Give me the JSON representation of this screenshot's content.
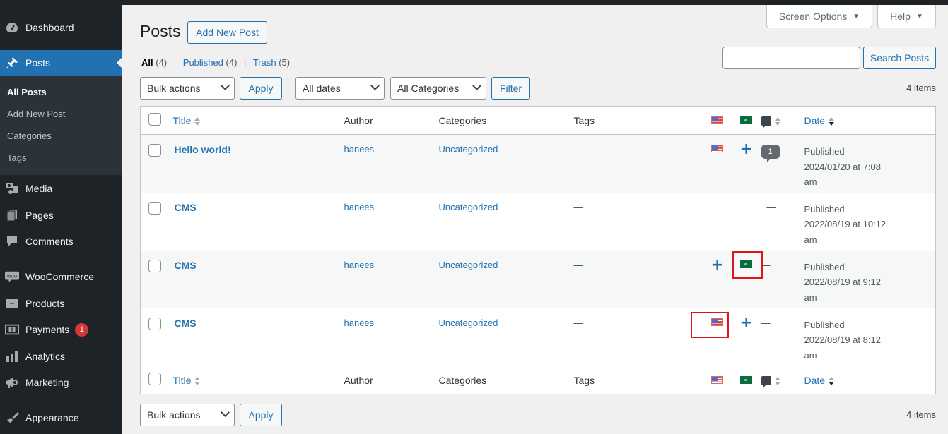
{
  "sidebar": {
    "items": [
      {
        "label": "Dashboard",
        "icon": "dashboard-icon"
      },
      {
        "label": "Posts",
        "icon": "pin-icon",
        "active": true
      },
      {
        "label": "Media",
        "icon": "media-icon"
      },
      {
        "label": "Pages",
        "icon": "pages-icon"
      },
      {
        "label": "Comments",
        "icon": "comments-icon"
      },
      {
        "label": "WooCommerce",
        "icon": "woocommerce-icon"
      },
      {
        "label": "Products",
        "icon": "archive-box-icon"
      },
      {
        "label": "Payments",
        "icon": "dollar-card-icon",
        "badge": "1"
      },
      {
        "label": "Analytics",
        "icon": "bar-chart-icon"
      },
      {
        "label": "Marketing",
        "icon": "megaphone-icon"
      },
      {
        "label": "Appearance",
        "icon": "paintbrush-icon"
      }
    ],
    "submenu": [
      "All Posts",
      "Add New Post",
      "Categories",
      "Tags"
    ]
  },
  "header": {
    "screen_options": "Screen Options",
    "help": "Help",
    "title": "Posts",
    "add_new": "Add New Post"
  },
  "views": {
    "all": "All",
    "all_count": "(4)",
    "published": "Published",
    "published_count": "(4)",
    "trash": "Trash",
    "trash_count": "(5)"
  },
  "filters": {
    "bulk_actions": "Bulk actions",
    "apply": "Apply",
    "dates": "All dates",
    "categories": "All Categories",
    "filter": "Filter",
    "search_value": "",
    "search_button": "Search Posts",
    "items_count": "4 items"
  },
  "table": {
    "columns": {
      "title": "Title",
      "author": "Author",
      "categories": "Categories",
      "tags": "Tags",
      "date": "Date"
    },
    "rows": [
      {
        "title": "Hello world!",
        "author": "hanees",
        "category": "Uncategorized",
        "tags": "—",
        "en": "flag",
        "ar": "plus",
        "comments": "1",
        "status": "Published",
        "date": "2024/01/20 at 7:08",
        "ampm": "am"
      },
      {
        "title": "CMS",
        "author": "hanees",
        "category": "Uncategorized",
        "tags": "—",
        "en": "",
        "ar": "",
        "comments": "—",
        "status": "Published",
        "date": "2022/08/19 at 10:12",
        "ampm": "am"
      },
      {
        "title": "CMS",
        "author": "hanees",
        "category": "Uncategorized",
        "tags": "—",
        "en": "plus",
        "ar": "flag",
        "comments": "—",
        "status": "Published",
        "date": "2022/08/19 at 9:12",
        "ampm": "am"
      },
      {
        "title": "CMS",
        "author": "hanees",
        "category": "Uncategorized",
        "tags": "—",
        "en": "flag",
        "ar": "plus",
        "comments": "—",
        "status": "Published",
        "date": "2022/08/19 at 8:12",
        "ampm": "am"
      }
    ]
  },
  "bottom": {
    "bulk_actions": "Bulk actions",
    "apply": "Apply",
    "items_count": "4 items"
  }
}
